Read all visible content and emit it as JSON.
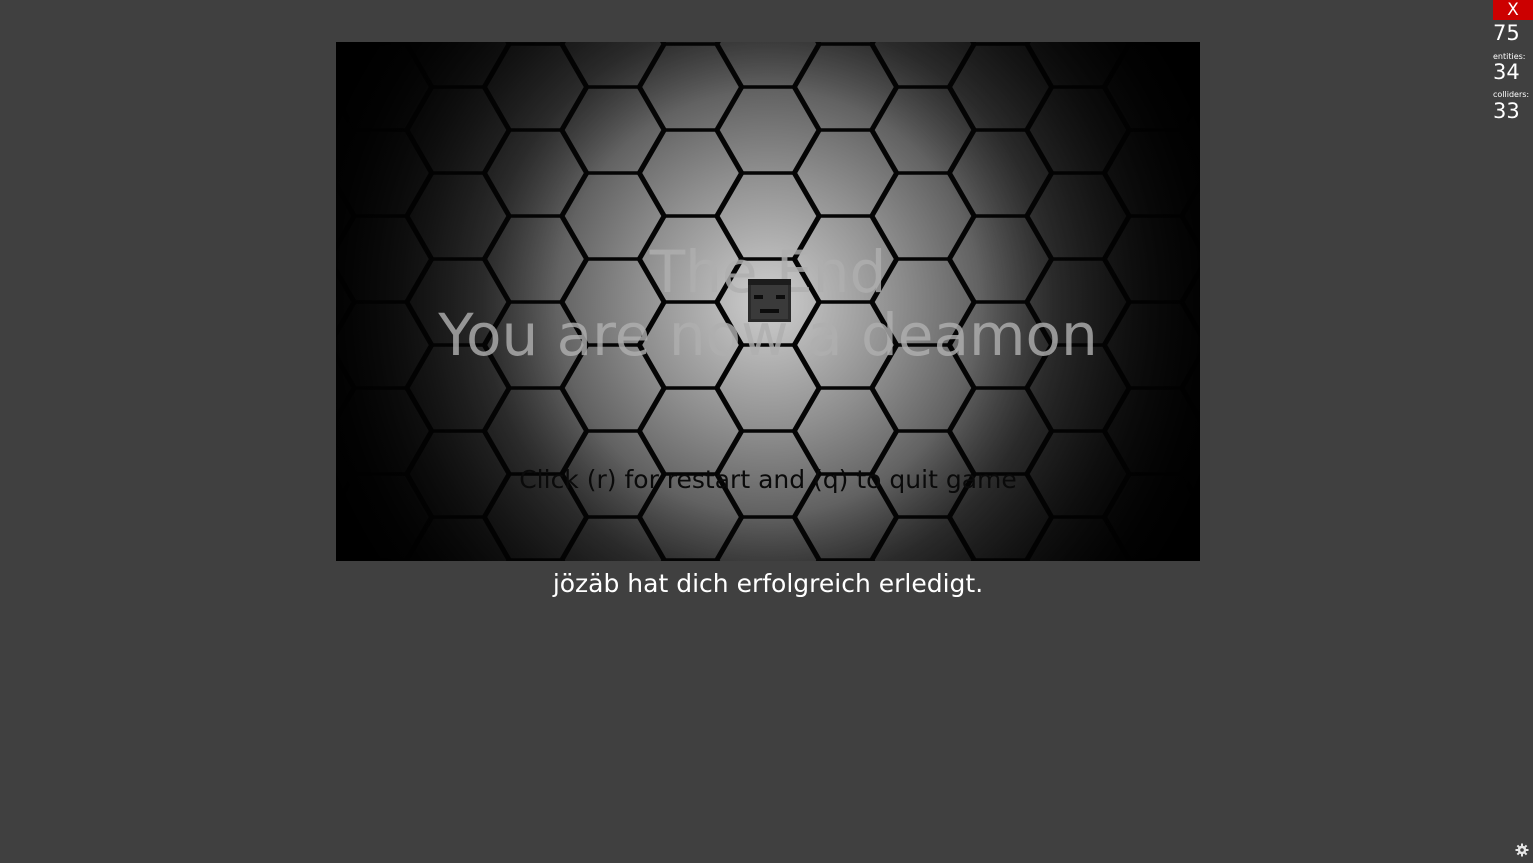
{
  "game": {
    "end_title": "The End",
    "end_subtitle": "You are now a deamon",
    "restart_hint": "Click (r) for restart and (q) to quit game"
  },
  "kill_message": "jözäb hat dich erfolgreich erledigt.",
  "stats": {
    "close_label": "X",
    "fps": "75",
    "entities_label": "entities:",
    "entities": "34",
    "colliders_label": "colliders:",
    "colliders": "33"
  },
  "icons": {
    "settings": "gear-icon",
    "player": "demon-sprite-icon"
  },
  "colors": {
    "background": "#404040",
    "close_button": "#cc0000",
    "text": "#ffffff"
  }
}
